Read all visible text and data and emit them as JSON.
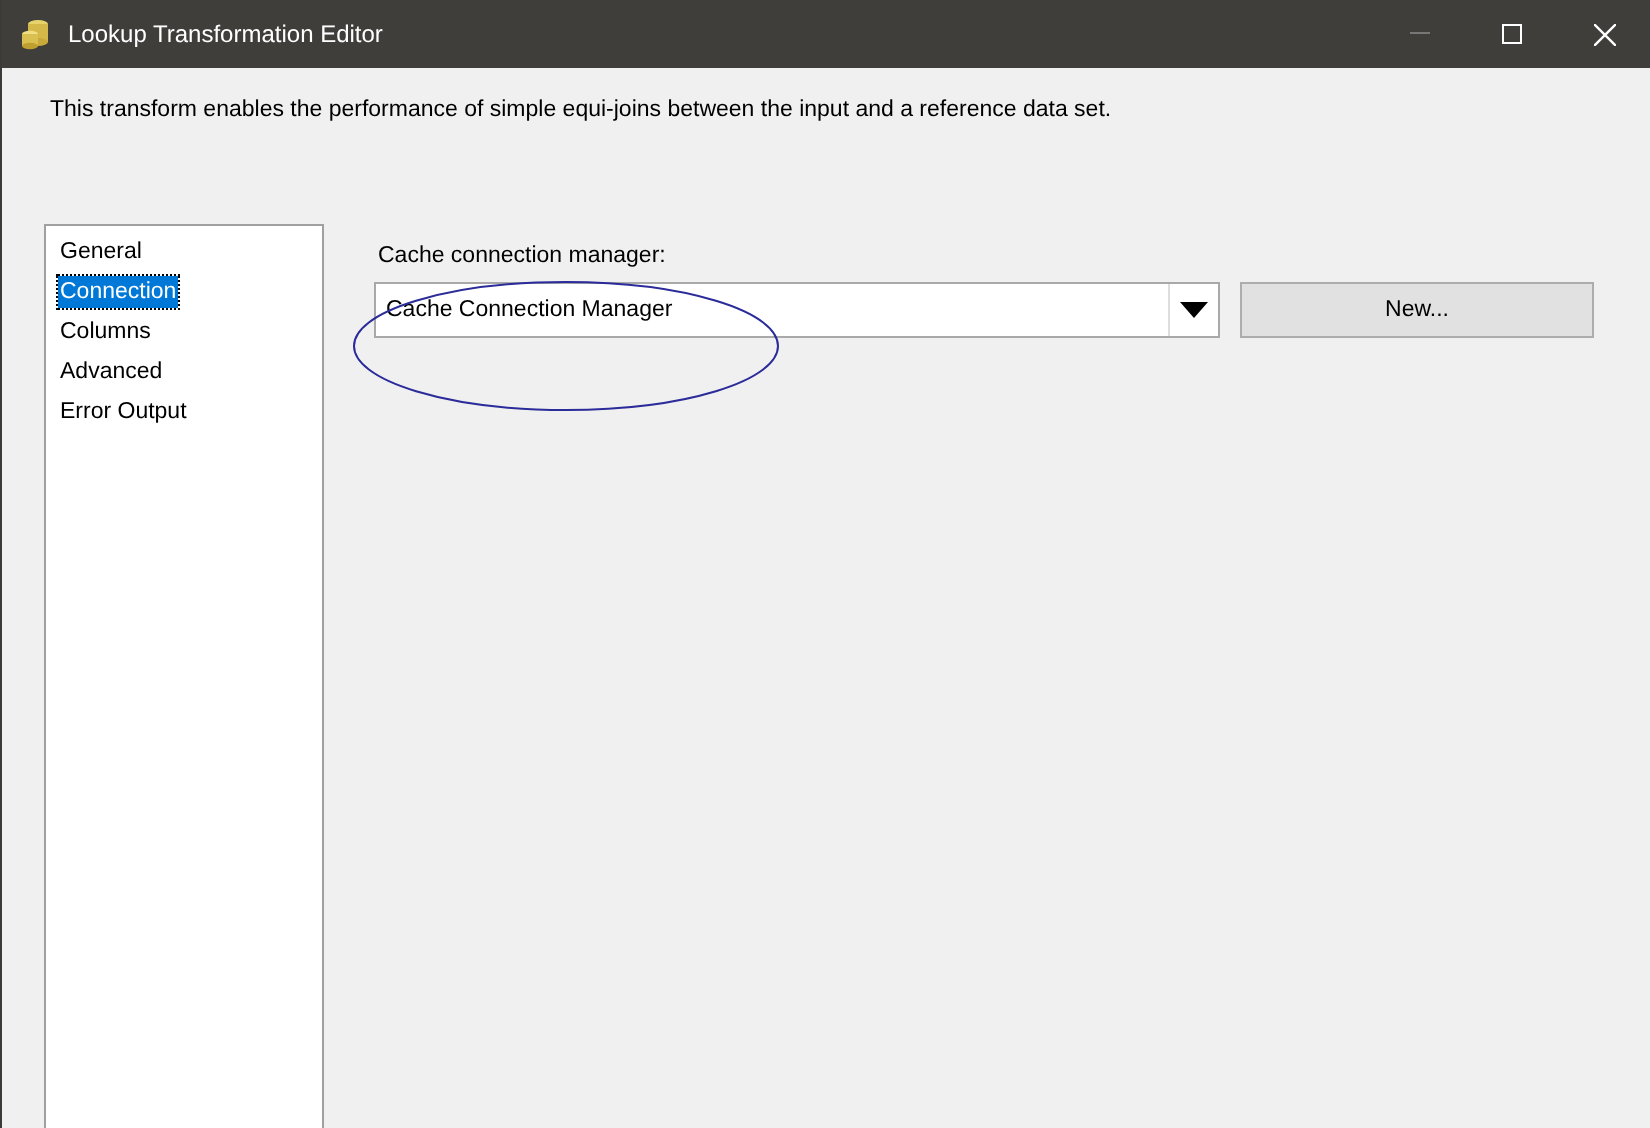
{
  "window": {
    "title": "Lookup Transformation Editor"
  },
  "description": "This transform enables the performance of simple equi-joins between the input and a reference data set.",
  "sidebar": {
    "items": [
      {
        "label": "General",
        "selected": false
      },
      {
        "label": "Connection",
        "selected": true
      },
      {
        "label": "Columns",
        "selected": false
      },
      {
        "label": "Advanced",
        "selected": false
      },
      {
        "label": "Error Output",
        "selected": false
      }
    ]
  },
  "connection": {
    "label": "Cache connection manager:",
    "value": "Cache Connection Manager",
    "new_button": "New..."
  }
}
